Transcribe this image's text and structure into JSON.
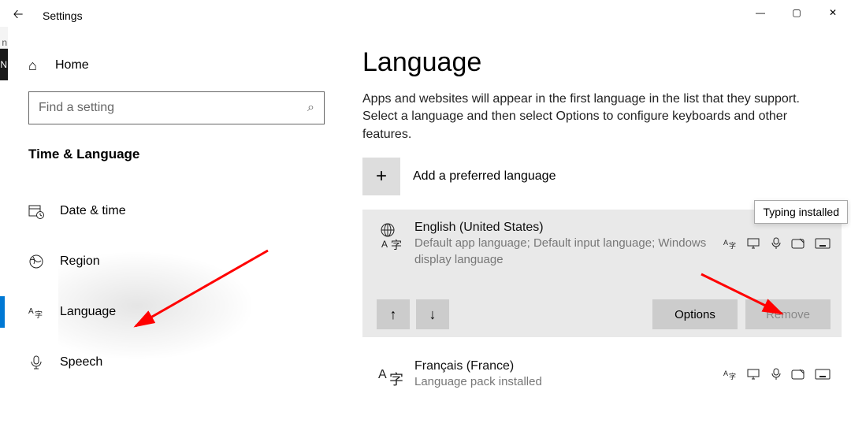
{
  "window": {
    "title": "Settings",
    "controls": {
      "min": "—",
      "max": "▢",
      "close": "✕"
    }
  },
  "sidebar": {
    "home_label": "Home",
    "search_placeholder": "Find a setting",
    "section_title": "Time & Language",
    "items": [
      {
        "label": "Date & time",
        "selected": false
      },
      {
        "label": "Region",
        "selected": false
      },
      {
        "label": "Language",
        "selected": true
      },
      {
        "label": "Speech",
        "selected": false
      }
    ]
  },
  "page": {
    "title": "Language",
    "description": "Apps and websites will appear in the first language in the list that they support. Select a language and then select Options to configure keyboards and other features.",
    "add_label": "Add a preferred language",
    "tooltip": "Typing installed",
    "options_label": "Options",
    "remove_label": "Remove",
    "languages": [
      {
        "name": "English (United States)",
        "subtitle": "Default app language; Default input language; Windows display language",
        "selected": true
      },
      {
        "name": "Français (France)",
        "subtitle": "Language pack installed",
        "selected": false
      }
    ]
  },
  "crumb": {
    "a": "n",
    "b": "N"
  }
}
